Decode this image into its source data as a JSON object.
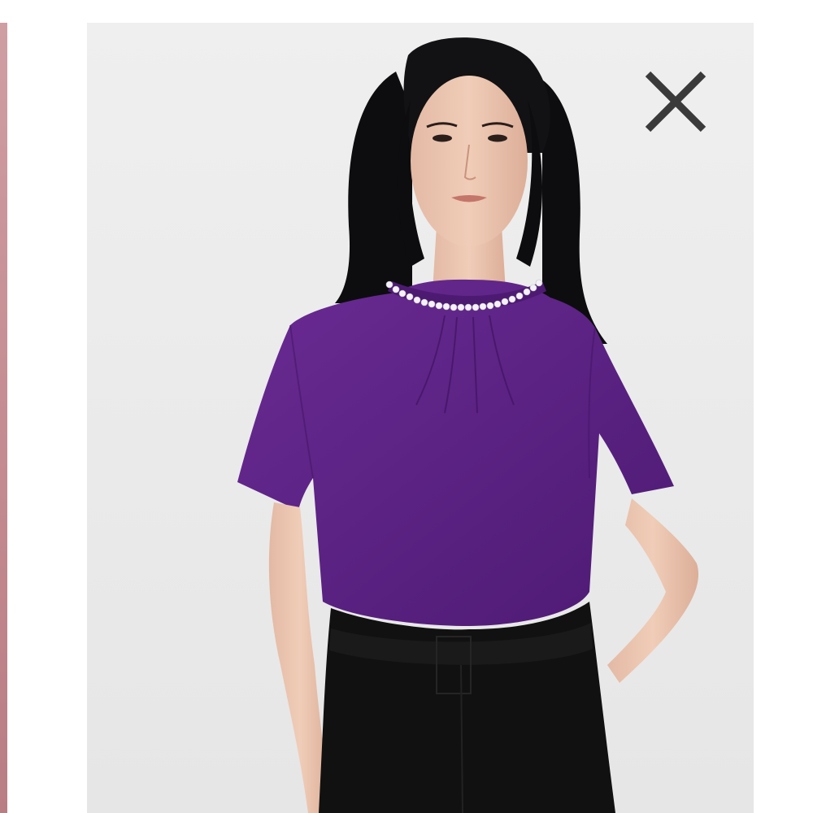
{
  "viewer": {
    "image_description_icon": "product-photo",
    "close_icon": "close-icon"
  },
  "colors": {
    "backdrop": "#ebebeb",
    "blouse": "#5e2486",
    "trousers": "#111111",
    "side_panel": "#c48b91",
    "close_icon": "#3a3a3a"
  }
}
